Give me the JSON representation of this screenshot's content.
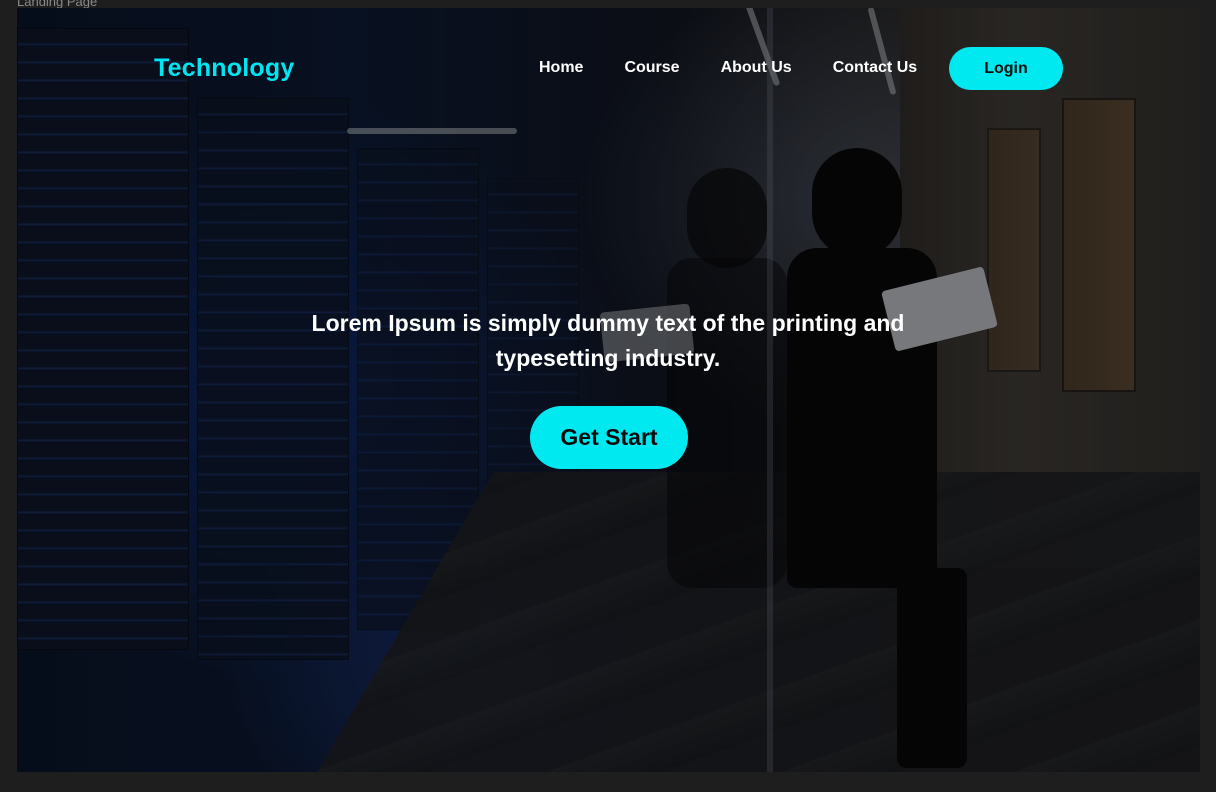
{
  "frame": {
    "label": "Landing Page"
  },
  "nav": {
    "brand": "Technology",
    "links": [
      "Home",
      "Course",
      "About Us",
      "Contact Us"
    ],
    "login_label": "Login"
  },
  "hero": {
    "headline": "Lorem Ipsum is simply dummy text of the printing and typesetting industry.",
    "cta_label": "Get Start"
  },
  "colors": {
    "accent": "#00e8f0",
    "brand_text": "#00e5f2",
    "page_background": "#1e1e1e"
  }
}
